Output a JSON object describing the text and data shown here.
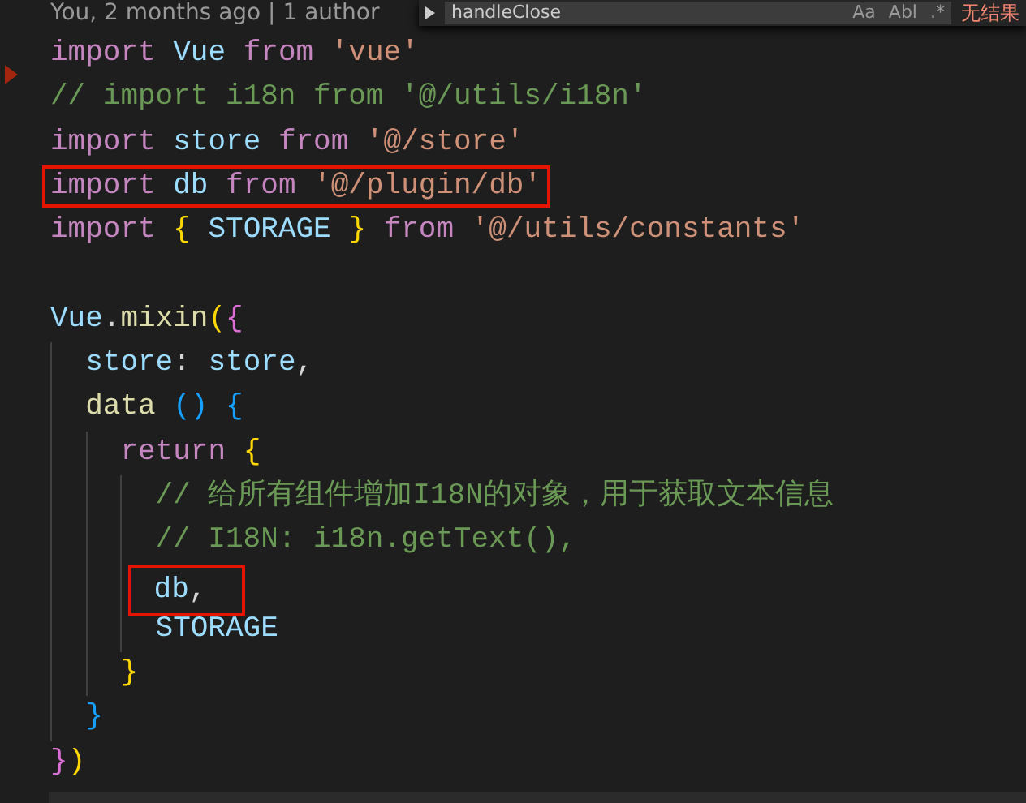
{
  "blame": "You, 2 months ago | 1 author",
  "find_widget": {
    "query": "handleClose",
    "options": [
      {
        "label": "Aa"
      },
      {
        "label": "Abl"
      },
      {
        "label": ".*"
      }
    ],
    "result": "无结果"
  },
  "lines": [
    {
      "kind": "code",
      "highlighted": false,
      "tokens": [
        {
          "t": "import ",
          "kind": "keyword"
        },
        {
          "t": "Vue ",
          "kind": "variable"
        },
        {
          "t": "from ",
          "kind": "keyword"
        },
        {
          "t": "'vue'",
          "kind": "string"
        }
      ]
    },
    {
      "kind": "code",
      "highlighted": false,
      "tokens": [
        {
          "t": "// import i18n from '@/utils/i18n'",
          "kind": "comment"
        }
      ]
    },
    {
      "kind": "code",
      "highlighted": false,
      "tokens": [
        {
          "t": "import ",
          "kind": "keyword"
        },
        {
          "t": "store ",
          "kind": "variable"
        },
        {
          "t": "from ",
          "kind": "keyword"
        },
        {
          "t": "'@/store'",
          "kind": "string"
        }
      ]
    },
    {
      "kind": "code",
      "highlighted": true,
      "tokens": [
        {
          "t": "import ",
          "kind": "keyword"
        },
        {
          "t": "db ",
          "kind": "variable"
        },
        {
          "t": "from ",
          "kind": "keyword"
        },
        {
          "t": "'@/plugin/db'",
          "kind": "string"
        }
      ]
    },
    {
      "kind": "code",
      "highlighted": false,
      "tokens": [
        {
          "t": "import ",
          "kind": "keyword"
        },
        {
          "t": "{ ",
          "kind": "brace1"
        },
        {
          "t": "STORAGE ",
          "kind": "variable"
        },
        {
          "t": "} ",
          "kind": "brace1"
        },
        {
          "t": "from ",
          "kind": "keyword"
        },
        {
          "t": "'@/utils/constants'",
          "kind": "string"
        }
      ]
    },
    {
      "kind": "blank"
    },
    {
      "kind": "code",
      "highlighted": false,
      "tokens": [
        {
          "t": "Vue",
          "kind": "variable"
        },
        {
          "t": ".",
          "kind": "punct"
        },
        {
          "t": "mixin",
          "kind": "function"
        },
        {
          "t": "(",
          "kind": "brace1"
        },
        {
          "t": "{",
          "kind": "brace2"
        }
      ]
    },
    {
      "kind": "code",
      "highlighted": false,
      "tokens": [
        {
          "t": "  store",
          "kind": "variable"
        },
        {
          "t": ": ",
          "kind": "punct"
        },
        {
          "t": "store",
          "kind": "variable"
        },
        {
          "t": ",",
          "kind": "punct"
        }
      ]
    },
    {
      "kind": "code",
      "highlighted": false,
      "tokens": [
        {
          "t": "  data ",
          "kind": "function"
        },
        {
          "t": "() {",
          "kind": "brace3"
        }
      ]
    },
    {
      "kind": "code",
      "highlighted": false,
      "tokens": [
        {
          "t": "    return ",
          "kind": "keyword"
        },
        {
          "t": "{",
          "kind": "brace1"
        }
      ]
    },
    {
      "kind": "code",
      "highlighted": false,
      "tokens": [
        {
          "t": "      // 给所有组件增加I18N的对象，用于获取文本信息",
          "kind": "comment"
        }
      ]
    },
    {
      "kind": "code",
      "highlighted": false,
      "tokens": [
        {
          "t": "      // I18N: i18n.getText(),",
          "kind": "comment"
        }
      ]
    },
    {
      "kind": "code",
      "highlighted": true,
      "tokens": [
        {
          "t": "      db",
          "kind": "variable"
        },
        {
          "t": ",",
          "kind": "punct"
        }
      ]
    },
    {
      "kind": "code",
      "highlighted": false,
      "tokens": [
        {
          "t": "      STORAGE",
          "kind": "variable"
        }
      ]
    },
    {
      "kind": "code",
      "highlighted": false,
      "tokens": [
        {
          "t": "    }",
          "kind": "brace1"
        }
      ]
    },
    {
      "kind": "code",
      "highlighted": false,
      "tokens": [
        {
          "t": "  }",
          "kind": "brace3"
        }
      ]
    },
    {
      "kind": "code",
      "highlighted": false,
      "tokens": [
        {
          "t": "}",
          "kind": "brace2"
        },
        {
          "t": ")",
          "kind": "brace1"
        }
      ]
    }
  ]
}
